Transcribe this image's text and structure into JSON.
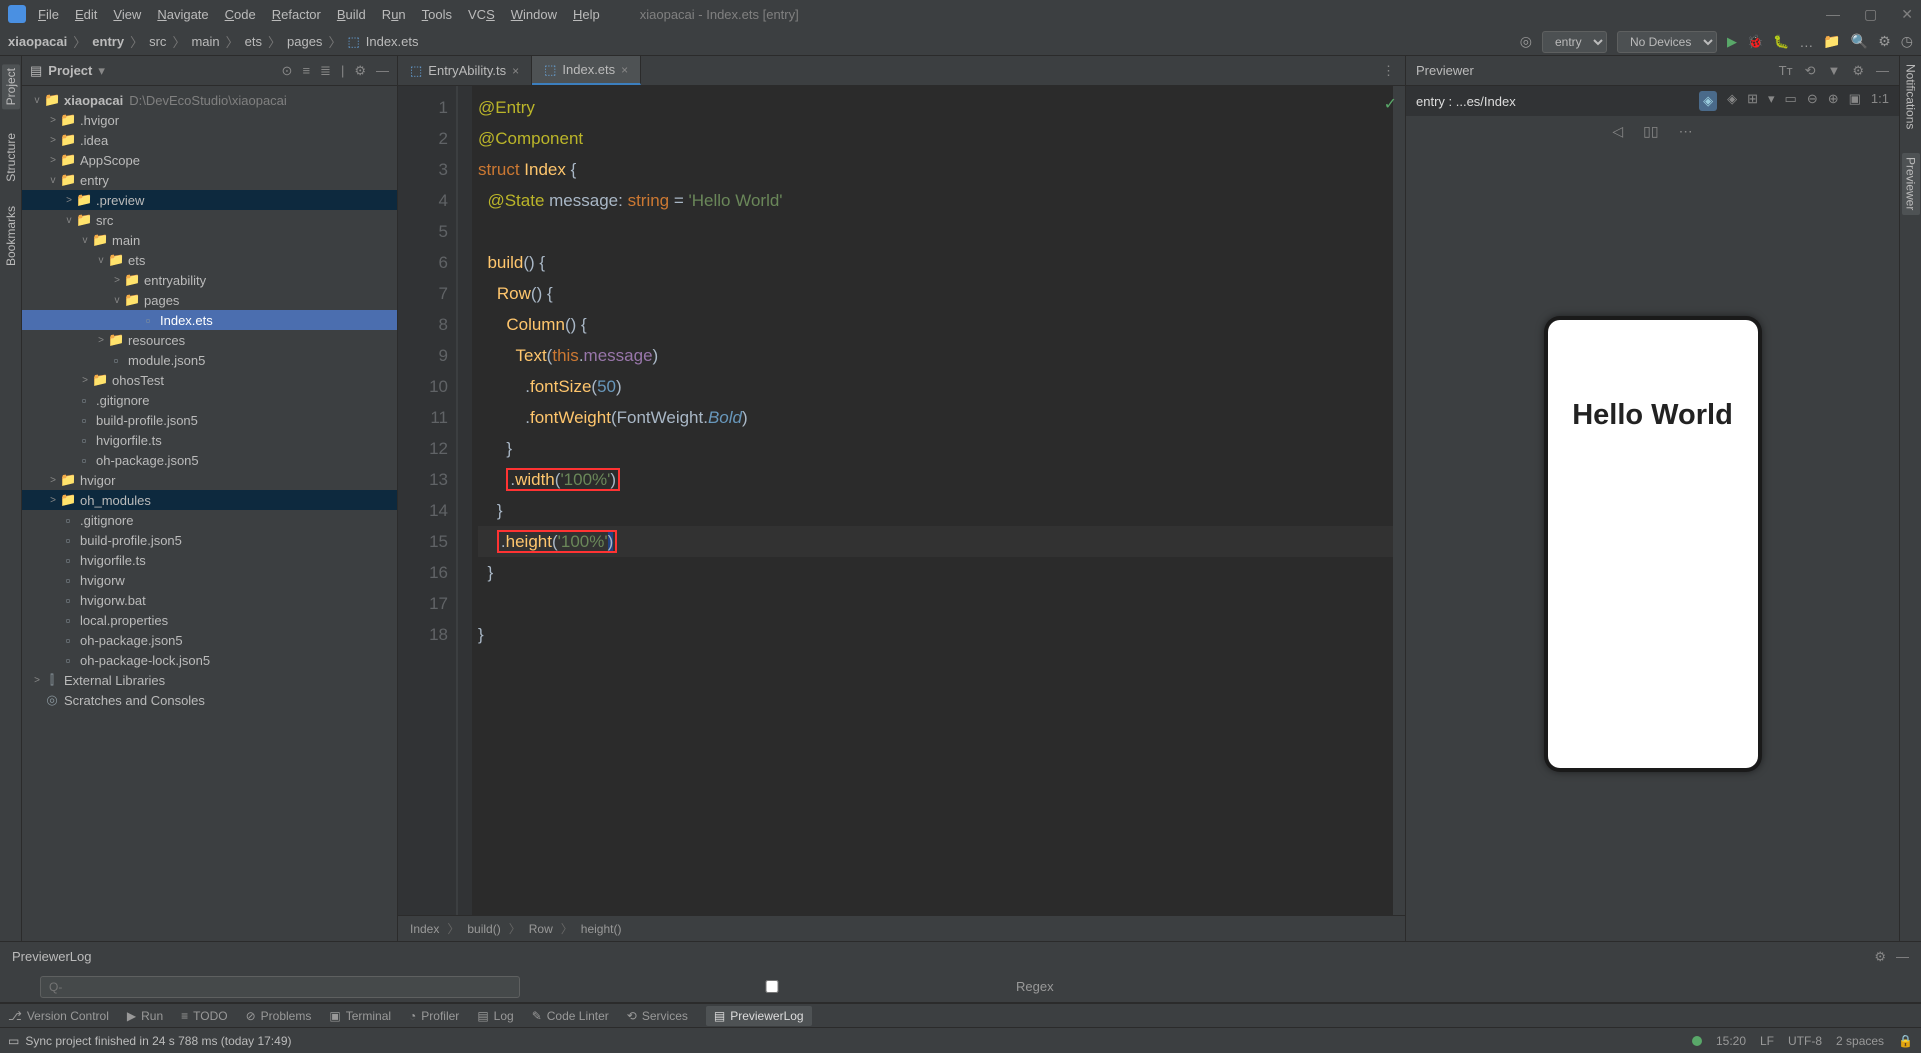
{
  "window_title": "xiaopacai - Index.ets [entry]",
  "menu": [
    "File",
    "Edit",
    "View",
    "Navigate",
    "Code",
    "Refactor",
    "Build",
    "Run",
    "Tools",
    "VCS",
    "Window",
    "Help"
  ],
  "breadcrumb": [
    "xiaopacai",
    "entry",
    "src",
    "main",
    "ets",
    "pages",
    "Index.ets"
  ],
  "module_selector": "entry",
  "device_selector": "No Devices",
  "sidebar": {
    "title": "Project",
    "root": {
      "name": "xiaopacai",
      "path": "D:\\DevEcoStudio\\xiaopacai"
    },
    "items": [
      {
        "pad": 1,
        "exp": ">",
        "ic": "folder",
        "label": ".hvigor"
      },
      {
        "pad": 1,
        "exp": ">",
        "ic": "folder",
        "label": ".idea"
      },
      {
        "pad": 1,
        "exp": ">",
        "ic": "folder",
        "label": "AppScope"
      },
      {
        "pad": 1,
        "exp": "v",
        "ic": "folder-b",
        "label": "entry",
        "sel": false
      },
      {
        "pad": 2,
        "exp": ">",
        "ic": "folder-o",
        "label": ".preview",
        "sel": true
      },
      {
        "pad": 2,
        "exp": "v",
        "ic": "folder",
        "label": "src"
      },
      {
        "pad": 3,
        "exp": "v",
        "ic": "folder",
        "label": "main"
      },
      {
        "pad": 4,
        "exp": "v",
        "ic": "folder",
        "label": "ets"
      },
      {
        "pad": 5,
        "exp": ">",
        "ic": "folder",
        "label": "entryability"
      },
      {
        "pad": 5,
        "exp": "v",
        "ic": "folder",
        "label": "pages"
      },
      {
        "pad": 6,
        "exp": "",
        "ic": "file",
        "label": "Index.ets",
        "sel2": true
      },
      {
        "pad": 4,
        "exp": ">",
        "ic": "folder",
        "label": "resources"
      },
      {
        "pad": 4,
        "exp": "",
        "ic": "file",
        "label": "module.json5"
      },
      {
        "pad": 3,
        "exp": ">",
        "ic": "folder",
        "label": "ohosTest"
      },
      {
        "pad": 2,
        "exp": "",
        "ic": "file",
        "label": ".gitignore"
      },
      {
        "pad": 2,
        "exp": "",
        "ic": "file",
        "label": "build-profile.json5"
      },
      {
        "pad": 2,
        "exp": "",
        "ic": "file",
        "label": "hvigorfile.ts"
      },
      {
        "pad": 2,
        "exp": "",
        "ic": "file",
        "label": "oh-package.json5"
      },
      {
        "pad": 1,
        "exp": ">",
        "ic": "folder",
        "label": "hvigor"
      },
      {
        "pad": 1,
        "exp": ">",
        "ic": "folder-o",
        "label": "oh_modules",
        "sel": true
      },
      {
        "pad": 1,
        "exp": "",
        "ic": "file",
        "label": ".gitignore"
      },
      {
        "pad": 1,
        "exp": "",
        "ic": "file",
        "label": "build-profile.json5"
      },
      {
        "pad": 1,
        "exp": "",
        "ic": "file",
        "label": "hvigorfile.ts"
      },
      {
        "pad": 1,
        "exp": "",
        "ic": "file",
        "label": "hvigorw"
      },
      {
        "pad": 1,
        "exp": "",
        "ic": "file",
        "label": "hvigorw.bat"
      },
      {
        "pad": 1,
        "exp": "",
        "ic": "file",
        "label": "local.properties"
      },
      {
        "pad": 1,
        "exp": "",
        "ic": "file",
        "label": "oh-package.json5"
      },
      {
        "pad": 1,
        "exp": "",
        "ic": "file",
        "label": "oh-package-lock.json5"
      },
      {
        "pad": 0,
        "exp": ">",
        "ic": "lib",
        "label": "External Libraries"
      },
      {
        "pad": 0,
        "exp": "",
        "ic": "scratch",
        "label": "Scratches and Consoles"
      }
    ]
  },
  "tabs": [
    {
      "label": "EntryAbility.ts",
      "active": false
    },
    {
      "label": "Index.ets",
      "active": true
    }
  ],
  "code_crumbs": [
    "Index",
    "build()",
    "Row",
    "height()"
  ],
  "previewer": {
    "title": "Previewer",
    "path": "entry : ...es/Index",
    "phone_text": "Hello World"
  },
  "left_tools": [
    "Project",
    "Structure",
    "Bookmarks"
  ],
  "right_tools": [
    "Notifications",
    "Previewer"
  ],
  "bottom_panel_title": "PreviewerLog",
  "search_placeholder": "Q-",
  "regex_label": "Regex",
  "toolstrip": [
    "Version Control",
    "Run",
    "TODO",
    "Problems",
    "Terminal",
    "Profiler",
    "Log",
    "Code Linter",
    "Services",
    "PreviewerLog"
  ],
  "status_msg": "Sync project finished in 24 s 788 ms (today 17:49)",
  "status_right": {
    "time": "15:20",
    "le": "LF",
    "enc": "UTF-8",
    "indent": "2 spaces"
  },
  "code": {
    "lines": [
      1,
      2,
      3,
      4,
      5,
      6,
      7,
      8,
      9,
      10,
      11,
      12,
      13,
      14,
      15,
      16,
      17,
      18
    ],
    "l1": "@Entry",
    "l2": "@Component",
    "l3_kw": "struct",
    "l3_id": "Index",
    "l3_b": " {",
    "l4_anno": "@State",
    "l4_var": " message",
    "l4_c": ": ",
    "l4_ty": "string",
    "l4_eq": " = ",
    "l4_str": "'Hello World'",
    "l6_fn": "build",
    "l6_p": "() {",
    "l7_fn": "Row",
    "l7_p": "() {",
    "l8_fn": "Column",
    "l8_p": "() {",
    "l9_fn": "Text",
    "l9_o": "(",
    "l9_this": "this",
    "l9_dot": ".",
    "l9_prop": "message",
    "l9_c": ")",
    "l10_dot": ".",
    "l10_fn": "fontSize",
    "l10_o": "(",
    "l10_num": "50",
    "l10_c": ")",
    "l11_dot": ".",
    "l11_fn": "fontWeight",
    "l11_o": "(",
    "l11_cls": "FontWeight",
    "l11_dot2": ".",
    "l11_v": "Bold",
    "l11_c": ")",
    "l12": "      }",
    "l13_dot": ".",
    "l13_fn": "width",
    "l13_o": "(",
    "l13_str": "'100%'",
    "l13_c": ")",
    "l14": "    }",
    "l15_dot": ".",
    "l15_fn": "height",
    "l15_o": "(",
    "l15_str": "'100%'",
    "l15_c": ")",
    "l16": "  }",
    "l18": "}"
  }
}
